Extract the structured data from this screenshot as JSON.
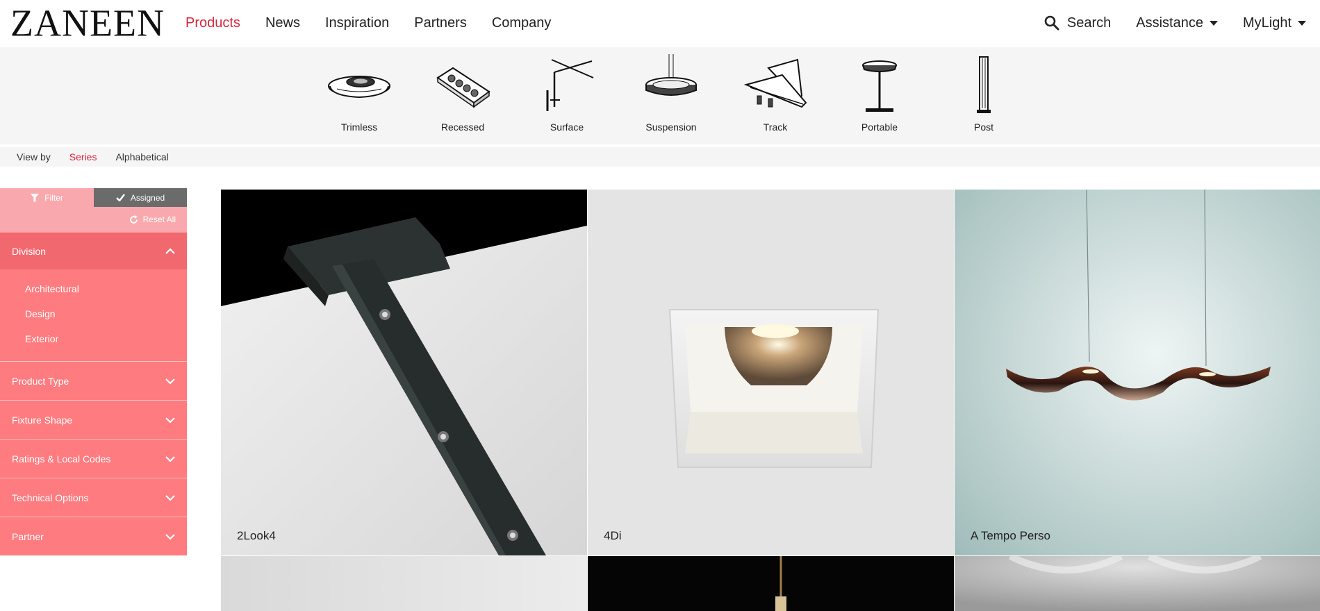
{
  "brand": {
    "logo_text": "ZANEEN"
  },
  "nav": {
    "items": [
      {
        "label": "Products",
        "active": true
      },
      {
        "label": "News",
        "active": false
      },
      {
        "label": "Inspiration",
        "active": false
      },
      {
        "label": "Partners",
        "active": false
      },
      {
        "label": "Company",
        "active": false
      }
    ],
    "search_label": "Search",
    "assistance_label": "Assistance",
    "mylight_label": "MyLight"
  },
  "categories": [
    {
      "label": "Trimless",
      "icon": "trimless-fixture-icon"
    },
    {
      "label": "Recessed",
      "icon": "recessed-fixture-icon"
    },
    {
      "label": "Surface",
      "icon": "surface-fixture-icon"
    },
    {
      "label": "Suspension",
      "icon": "suspension-fixture-icon"
    },
    {
      "label": "Track",
      "icon": "track-fixture-icon"
    },
    {
      "label": "Portable",
      "icon": "portable-fixture-icon"
    },
    {
      "label": "Post",
      "icon": "post-fixture-icon"
    }
  ],
  "view_by": {
    "label": "View by",
    "options": [
      {
        "label": "Series",
        "active": true
      },
      {
        "label": "Alphabetical",
        "active": false
      }
    ]
  },
  "filters": {
    "filter_tab": "Filter",
    "assigned_tab": "Assigned",
    "reset_label": "Reset All",
    "sections": [
      {
        "title": "Division",
        "expanded": true,
        "options": [
          "Architectural",
          "Design",
          "Exterior"
        ]
      },
      {
        "title": "Product Type",
        "expanded": false
      },
      {
        "title": "Fixture Shape",
        "expanded": false
      },
      {
        "title": "Ratings & Local Codes",
        "expanded": false
      },
      {
        "title": "Technical Options",
        "expanded": false
      },
      {
        "title": "Partner",
        "expanded": false
      }
    ]
  },
  "products": [
    {
      "name": "2Look4"
    },
    {
      "name": "4Di"
    },
    {
      "name": "A Tempo Perso"
    },
    {
      "name": ""
    },
    {
      "name": ""
    },
    {
      "name": ""
    }
  ],
  "colors": {
    "accent": "#d7263d",
    "sidebar_light": "#f9a9ad",
    "sidebar_header": "#f1696f",
    "sidebar_body": "#fe7b7f",
    "assigned_tab": "#6b6b6b",
    "band_bg": "#f5f5f5"
  }
}
